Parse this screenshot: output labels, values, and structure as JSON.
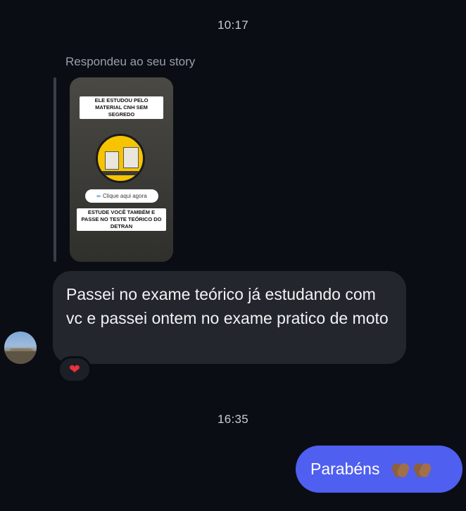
{
  "timestamps": {
    "first": "10:17",
    "second": "16:35"
  },
  "story_reply": {
    "label": "Respondeu ao seu story",
    "story": {
      "top_text": "ELE ESTUDOU PELO MATERIAL CNH SEM SEGREDO",
      "link_text": "Clique aqui agora",
      "bottom_text": "ESTUDE VOCÊ TAMBÉM E PASSE NO TESTE TEÓRICO DO DETRAN"
    }
  },
  "incoming_message": {
    "text": "Passei no exame teórico já estudando com vc e passei ontem no exame pratico de moto",
    "reaction": "❤"
  },
  "outgoing_message": {
    "text": "Parabéns",
    "emoji_names": [
      "clapping-hands-icon",
      "clapping-hands-icon"
    ]
  },
  "colors": {
    "background": "#0b0d15",
    "incoming_bubble": "#24262e",
    "outgoing_bubble": "#4f5ff0",
    "timestamp": "#c9ccd4"
  }
}
